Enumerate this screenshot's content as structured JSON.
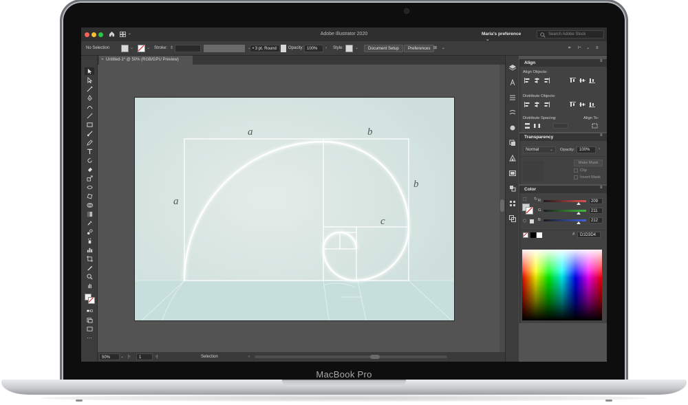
{
  "device": {
    "label": "MacBook Pro"
  },
  "window": {
    "title": "Adobe Illustrator 2020",
    "profile": "Maria's preference",
    "search_placeholder": "Search Adobe Stock"
  },
  "control_bar": {
    "selection": "No Selection",
    "stroke_label": "Stroke:",
    "brush": "3 pt. Round",
    "opacity_label": "Opacity:",
    "opacity_value": "100%",
    "style_label": "Style:",
    "document_setup": "Document Setup",
    "preferences": "Preferences"
  },
  "document_tab": {
    "close": "×",
    "title": "Untitled-1* @ 50% (RGB/GPU Preview)"
  },
  "artwork": {
    "labels": [
      "a",
      "b",
      "a",
      "b",
      "c"
    ]
  },
  "status_bar": {
    "zoom": "50%",
    "page": "1",
    "mode": "Selection"
  },
  "align_panel": {
    "title": "Align",
    "align_objects": "Align Objects:",
    "distribute_objects": "Distribute Objects:",
    "distribute_spacing": "Distribute Spacing:",
    "align_to": "Align To:"
  },
  "transparency_panel": {
    "title": "Transparency",
    "blend_mode": "Normal",
    "opacity_label": "Opacity:",
    "opacity_value": "100%",
    "make_mask": "Make Mask",
    "clip": "Clip",
    "invert_mask": "Invert Mask"
  },
  "color_panel": {
    "title": "Color",
    "channels": [
      {
        "label": "R",
        "value": "209",
        "level": 0.82,
        "color": "#e05050"
      },
      {
        "label": "G",
        "value": "211",
        "level": 0.83,
        "color": "#40c040"
      },
      {
        "label": "B",
        "value": "212",
        "level": 0.83,
        "color": "#4060e0"
      }
    ],
    "hex": "D1D3D4"
  },
  "colors": {
    "artboard": "#d5e3df",
    "floor": "#c8dfdd",
    "curve": "#ffffff",
    "ui_dark": "#2f2f2f",
    "ui_mid": "#535353"
  }
}
